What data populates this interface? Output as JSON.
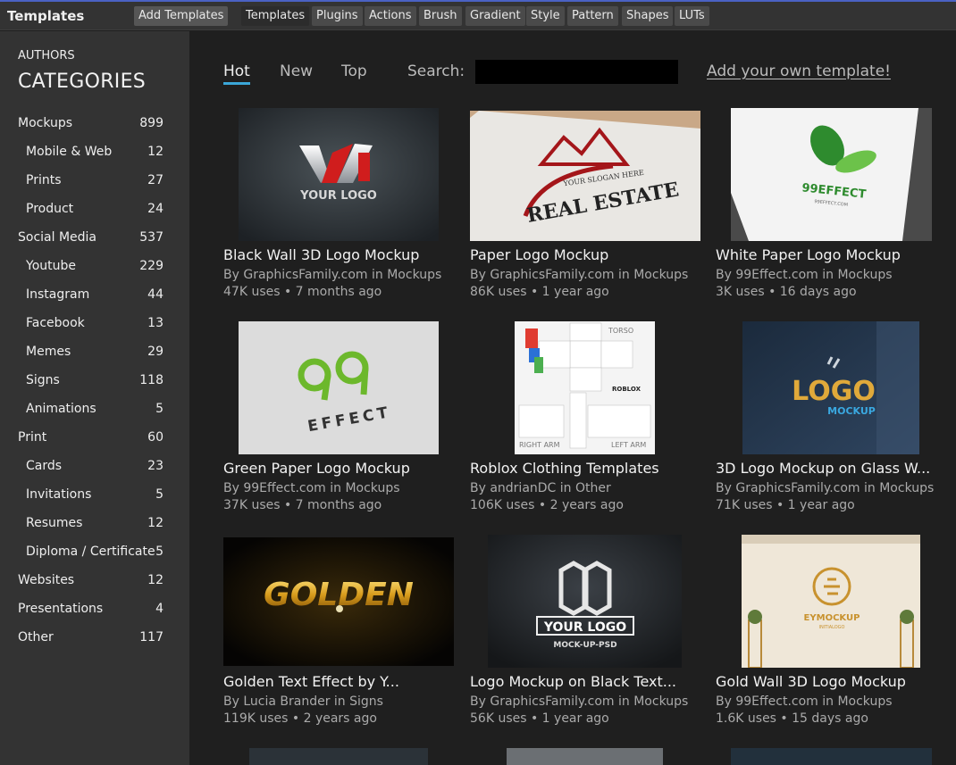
{
  "app": {
    "title": "Templates",
    "add_button": "Add Templates",
    "tabs": [
      "Templates",
      "Plugins",
      "Actions",
      "Brush",
      "Gradient",
      "Style",
      "Pattern",
      "Shapes",
      "LUTs"
    ]
  },
  "sidebar": {
    "authors_label": "AUTHORS",
    "categories_label": "CATEGORIES",
    "items": [
      {
        "label": "Mockups",
        "count": "899"
      },
      {
        "label": "Mobile & Web",
        "count": "12"
      },
      {
        "label": "Prints",
        "count": "27"
      },
      {
        "label": "Product",
        "count": "24"
      },
      {
        "label": "Social Media",
        "count": "537"
      },
      {
        "label": "Youtube",
        "count": "229"
      },
      {
        "label": "Instagram",
        "count": "44"
      },
      {
        "label": "Facebook",
        "count": "13"
      },
      {
        "label": "Memes",
        "count": "29"
      },
      {
        "label": "Signs",
        "count": "118"
      },
      {
        "label": "Animations",
        "count": "5"
      },
      {
        "label": "Print",
        "count": "60"
      },
      {
        "label": "Cards",
        "count": "23"
      },
      {
        "label": "Invitations",
        "count": "5"
      },
      {
        "label": "Resumes",
        "count": "12"
      },
      {
        "label": "Diploma / Certificate",
        "count": "5"
      },
      {
        "label": "Websites",
        "count": "12"
      },
      {
        "label": "Presentations",
        "count": "4"
      },
      {
        "label": "Other",
        "count": "117"
      }
    ]
  },
  "main": {
    "sort_tabs": [
      "Hot",
      "New",
      "Top"
    ],
    "search_label": "Search:",
    "search_value": "",
    "add_own_link": "Add your own template!",
    "cards": [
      {
        "title": "Black Wall 3D Logo Mockup",
        "by": "By GraphicsFamily.com in Mockups",
        "uses": "47K uses • 7 months ago",
        "thumb_text": "YOUR LOGO"
      },
      {
        "title": "Paper Logo Mockup",
        "by": "By GraphicsFamily.com in Mockups",
        "uses": "86K uses • 1 year ago",
        "thumb_text": "REAL ESTATE",
        "thumb_text2": "YOUR SLOGAN HERE"
      },
      {
        "title": "White Paper Logo Mockup",
        "by": "By 99Effect.com in Mockups",
        "uses": "3K uses • 16 days ago",
        "thumb_text": "99EFFECT",
        "thumb_text2": "99EFFECT.COM"
      },
      {
        "title": "Green Paper Logo Mockup",
        "by": "By 99Effect.com in Mockups",
        "uses": "37K uses • 7 months ago",
        "thumb_text": "EFFECT"
      },
      {
        "title": "Roblox Clothing Templates",
        "by": "By andrianDC in Other",
        "uses": "106K uses • 2 years ago",
        "thumb_text": "TORSO",
        "thumb_text2": "RIGHT ARM",
        "thumb_text3": "LEFT ARM",
        "thumb_text4": "ROBLOX"
      },
      {
        "title": "3D Logo Mockup on Glass W...",
        "by": "By GraphicsFamily.com in Mockups",
        "uses": "71K uses • 1 year ago",
        "thumb_text": "LOGO",
        "thumb_text2": "MOCKUP"
      },
      {
        "title": "Golden Text Effect by Y...",
        "by": "By Lucia Brander in Signs",
        "uses": "119K uses • 2 years ago",
        "thumb_text": "GOLDEN"
      },
      {
        "title": "Logo Mockup on Black Text...",
        "by": "By GraphicsFamily.com in Mockups",
        "uses": "56K uses • 1 year ago",
        "thumb_text": "YOUR LOGO",
        "thumb_text2": "MOCK-UP-PSD"
      },
      {
        "title": "Gold Wall 3D Logo Mockup",
        "by": "By 99Effect.com in Mockups",
        "uses": "1.6K uses • 15 days ago",
        "thumb_text": "EYMOCKUP",
        "thumb_text2": "INITIALOGO"
      }
    ]
  },
  "colors": {
    "accent": "#3ba7d8",
    "top_accent": "#4a62c4",
    "panel": "#333333",
    "background": "#1f1f1f"
  }
}
